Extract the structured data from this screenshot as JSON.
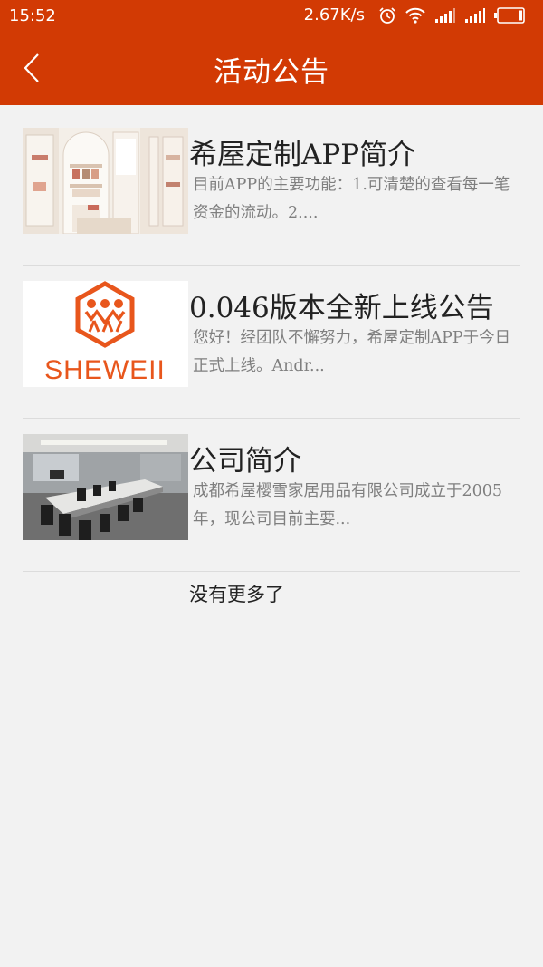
{
  "status_bar": {
    "time": "15:52",
    "net_speed": "2.67K/s",
    "icons": [
      "alarm-icon",
      "wifi-icon",
      "signal-icon",
      "signal-icon",
      "battery-icon"
    ]
  },
  "app_bar": {
    "title": "活动公告",
    "back_icon": "chevron-left-icon",
    "color": "#d23a04"
  },
  "announcements": [
    {
      "title": "希屋定制APP简介",
      "description": "目前APP的主要功能：1.可清楚的查看每一笔资金的流动。2....",
      "thumbnail": "wardrobe-interior"
    },
    {
      "title": "0.046版本全新上线公告",
      "description": "您好！经团队不懈努力，希屋定制APP于今日正式上线。Andr...",
      "thumbnail": "sheweii-logo",
      "logo_text": "SHEWEII",
      "brand_color": "#e8561c"
    },
    {
      "title": "公司简介",
      "description": "成都希屋樱雪家居用品有限公司成立于2005年，现公司目前主要...",
      "thumbnail": "conference-room"
    }
  ],
  "footer": {
    "no_more_text": "没有更多了"
  }
}
